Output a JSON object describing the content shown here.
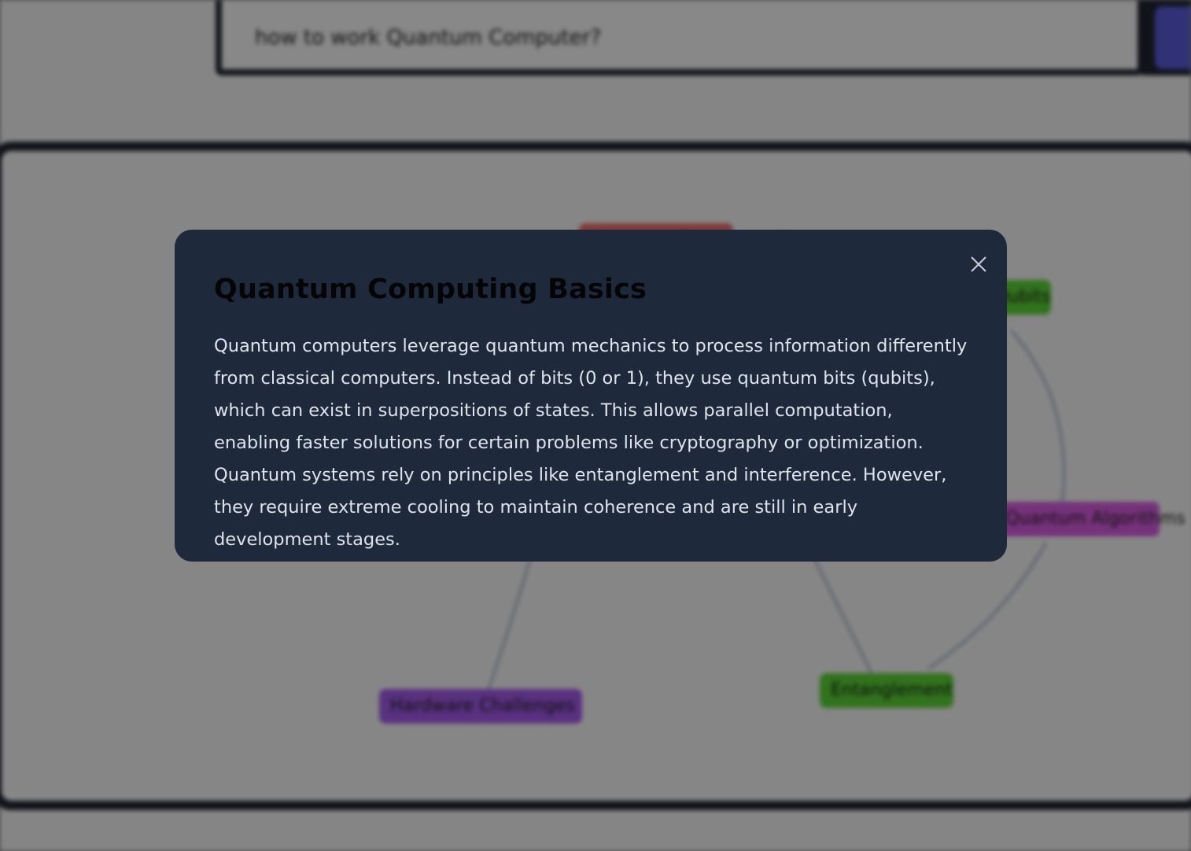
{
  "search": {
    "value": "how to work Quantum Computer?"
  },
  "mindmap": {
    "nodes": [
      {
        "label": "Hardware Challenges",
        "color": "#a259e8"
      },
      {
        "label": "Entanglement",
        "color": "#5ad136"
      },
      {
        "label": "Quantum Algorithms",
        "color": "#d65ce0"
      },
      {
        "label": "Qubits",
        "color": "#5ad136"
      },
      {
        "label": "Quantum Computing Basics",
        "color": "#e86a6a"
      }
    ]
  },
  "modal": {
    "title": "Quantum Computing Basics",
    "body": "Quantum computers leverage quantum mechanics to process information differently from classical computers. Instead of bits (0 or 1), they use quantum bits (qubits), which can exist in superpositions of states. This allows parallel computation, enabling faster solutions for certain problems like cryptography or optimization. Quantum systems rely on principles like entanglement and interference. However, they require extreme cooling to maintain coherence and are still in early development stages.",
    "close_icon": "close-icon"
  },
  "colors": {
    "modal_bg": "#1e293b",
    "title": "#050505",
    "body_text": "#dfe3ea",
    "overlay": "rgba(0,0,0,0.45)",
    "accent": "#5a5ad6"
  }
}
